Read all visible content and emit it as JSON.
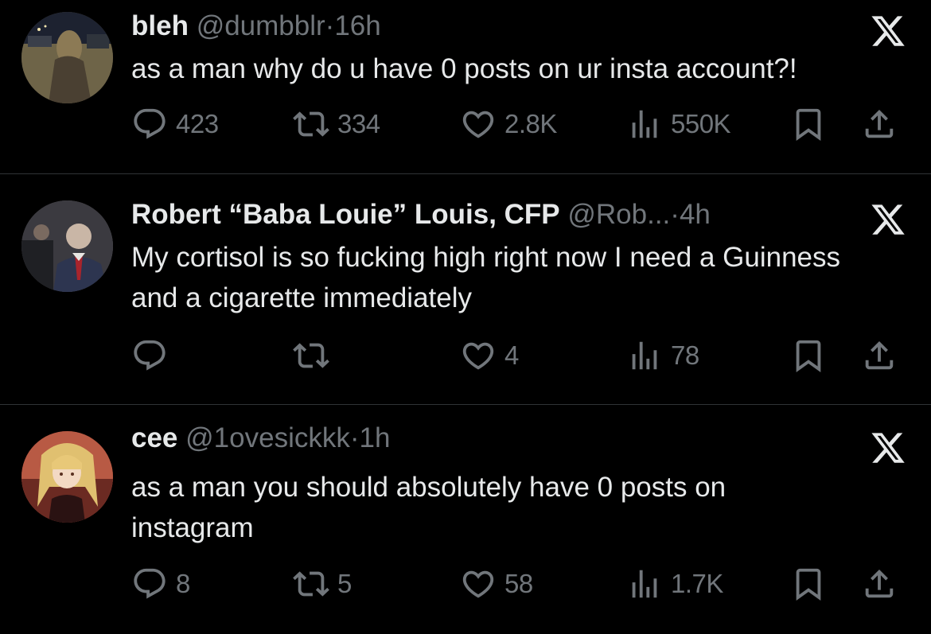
{
  "colors": {
    "background": "#000000",
    "text_primary": "#e7e9ea",
    "text_secondary": "#71767b",
    "divider": "#2f3336"
  },
  "icons": {
    "reply": "speech-bubble-icon",
    "repost": "repost-arrows-icon",
    "like": "heart-icon",
    "views": "bar-chart-icon",
    "bookmark": "bookmark-icon",
    "share": "share-upload-icon",
    "logo": "x-logo-icon"
  },
  "tweets": [
    {
      "display_name": "bleh",
      "handle": "@dumbblr",
      "separator": "·",
      "time": "16h",
      "text": "as a man why do u have 0 posts on ur insta account?!",
      "replies": "423",
      "reposts": "334",
      "likes": "2.8K",
      "views": "550K"
    },
    {
      "display_name": "Robert “Baba Louie” Louis, CFP",
      "handle": "@Rob...",
      "separator": "·",
      "time": "4h",
      "text": "My cortisol is so fucking high right now I need a Guinness and a cigarette immediately",
      "replies": "",
      "reposts": "",
      "likes": "4",
      "views": "78"
    },
    {
      "display_name": "cee",
      "handle": "@1ovesickkk",
      "separator": "·",
      "time": "1h",
      "text": "as a man you should absolutely have 0 posts on instagram",
      "replies": "8",
      "reposts": "5",
      "likes": "58",
      "views": "1.7K"
    }
  ]
}
